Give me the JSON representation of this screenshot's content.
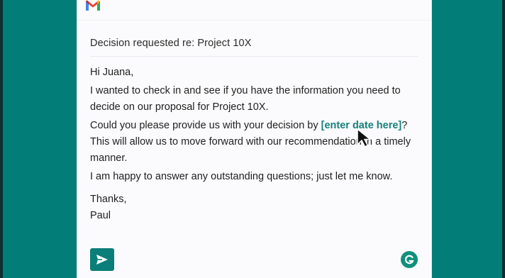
{
  "window": {
    "app": "Gmail"
  },
  "email": {
    "subject": "Decision requested re: Project 10X",
    "greeting": "Hi Juana,",
    "para1": "I wanted to check in and see if you have the information you need to decide on our proposal for Project 10X.",
    "para2_before": "Could you please provide us with your decision by ",
    "para2_placeholder": "[enter date here]",
    "para2_after": "? This will allow us to move forward with our recommendation in a timely manner.",
    "para3": "I am happy to answer any outstanding questions; just let me know.",
    "closing": "Thanks,",
    "signature": "Paul"
  },
  "icons": {
    "logo": "gmail-logo-icon",
    "send": "send-icon",
    "assistant": "grammarly-icon",
    "cursor": "mouse-pointer-icon"
  },
  "colors": {
    "background": "#037d78",
    "accent": "#0b7e79",
    "placeholder": "#16807b",
    "grammarly": "#118f7d"
  }
}
